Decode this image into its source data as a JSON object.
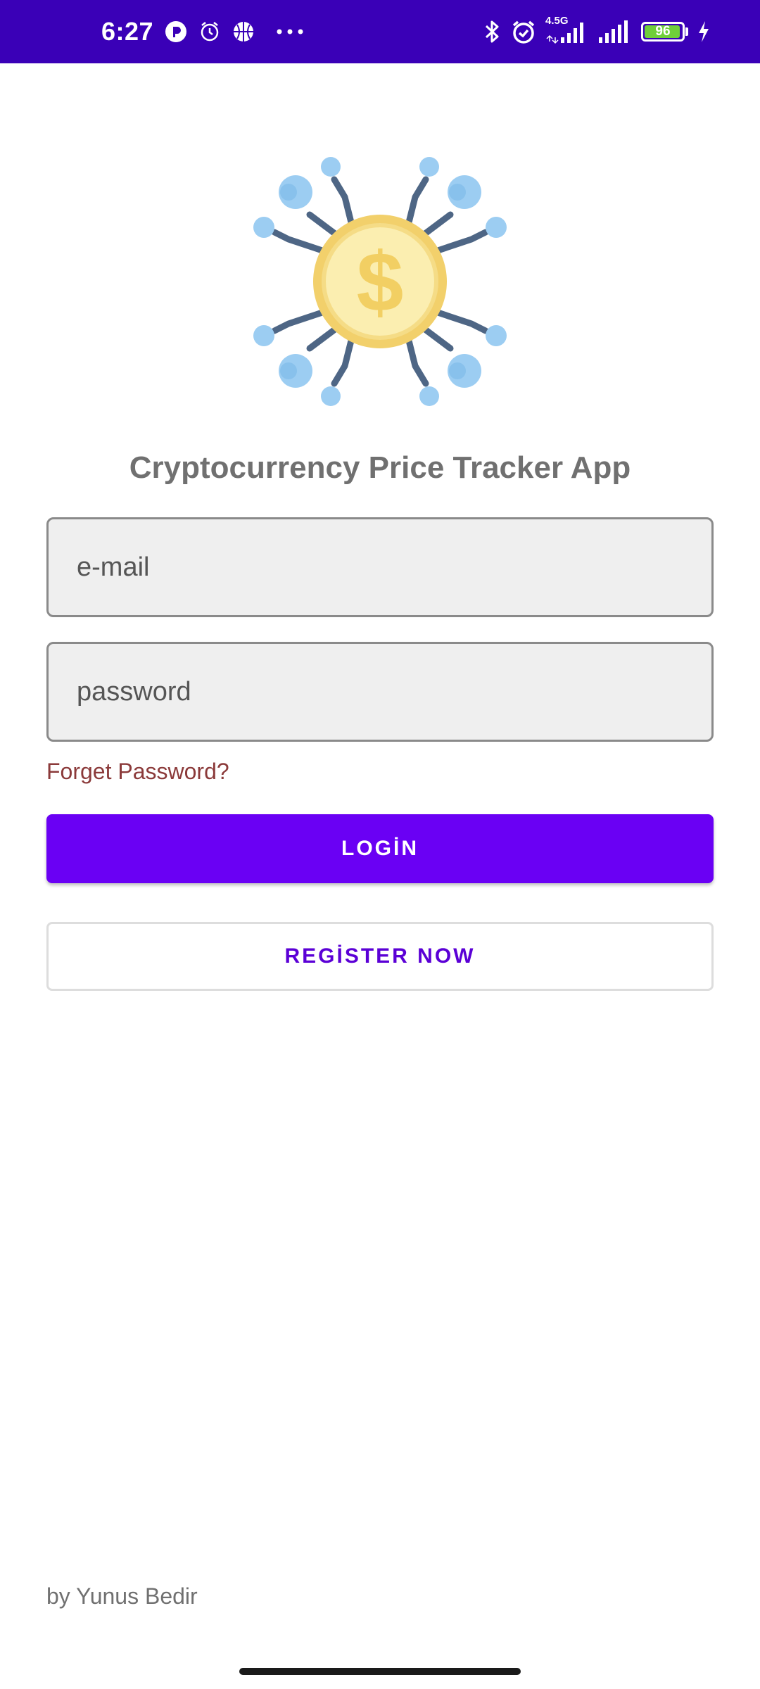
{
  "status_bar": {
    "time": "6:27",
    "network_type": "4.5G",
    "battery_level": "96",
    "icons": [
      "p-app-icon",
      "alarm-icon",
      "basketball-icon",
      "more-dots-icon",
      "bluetooth-icon",
      "alarm-icon",
      "signal-icon",
      "signal-icon",
      "battery-icon",
      "charging-icon"
    ],
    "background_color": "#3a00b7"
  },
  "app": {
    "logo_icon": "crypto-coin-network-icon",
    "title": "Cryptocurrency Price Tracker App"
  },
  "login_form": {
    "email_placeholder": "e-mail",
    "email_value": "",
    "password_placeholder": "password",
    "password_value": "",
    "forget_password_label": "Forget Password?",
    "login_label": "LOGİN",
    "register_label": "REGİSTER NOW"
  },
  "footer": {
    "credit": "by Yunus Bedir"
  },
  "colors": {
    "primary": "#6a00f4",
    "register_text": "#5b00d6",
    "link": "#8b3a3a",
    "title": "#707070"
  }
}
